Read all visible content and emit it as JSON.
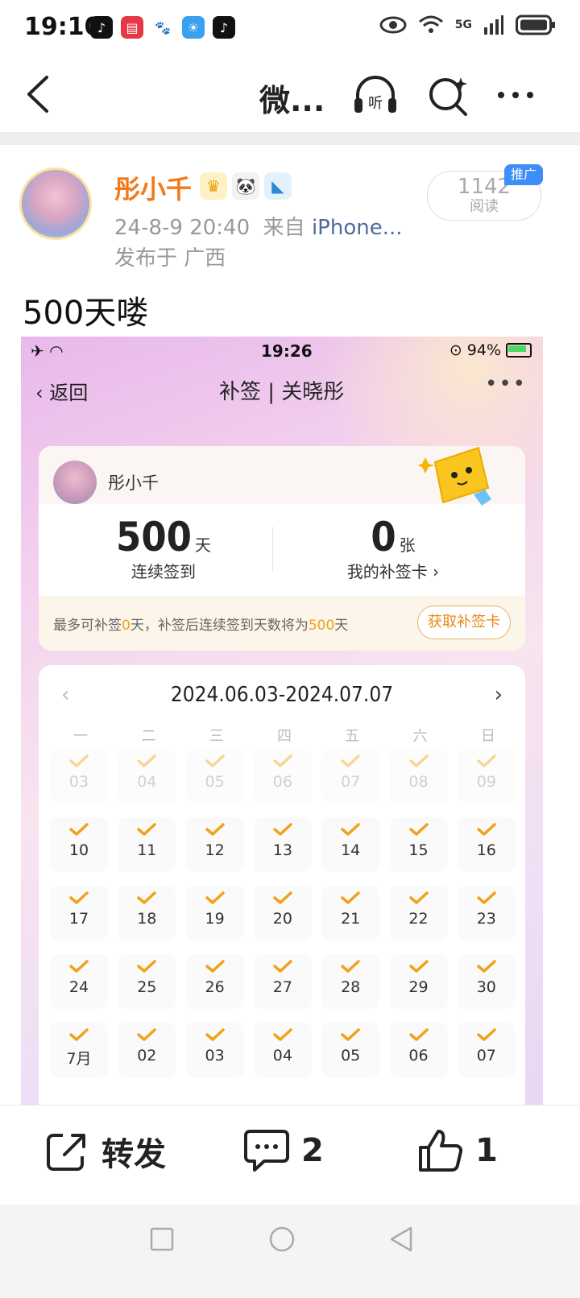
{
  "status_bar": {
    "time": "19:10",
    "network": "5G"
  },
  "nav": {
    "title": "微..."
  },
  "post": {
    "author": "彤小千",
    "date": "24-8-9 20:40",
    "source_prefix": "来自",
    "source": "iPhone...",
    "location": "发布于 广西",
    "read_count": "1142",
    "read_label": "阅读",
    "ad_tag": "推广",
    "text": "500天喽"
  },
  "screenshot": {
    "status_time": "19:26",
    "battery": "94%",
    "back_label": "返回",
    "title": "补签 | 关晓彤",
    "user_name": "彤小千",
    "streak_value": "500",
    "streak_unit": "天",
    "streak_label": "连续签到",
    "card_value": "0",
    "card_unit": "张",
    "card_label": "我的补签卡",
    "tip_a": "最多可补签",
    "tip_b": "0",
    "tip_c": "天，补签后连续签到天数将为",
    "tip_d": "500",
    "tip_e": "天",
    "get_card_button": "获取补签卡",
    "calendar_range": "2024.06.03-2024.07.07",
    "weekdays": [
      "一",
      "二",
      "三",
      "四",
      "五",
      "六",
      "日"
    ],
    "days": [
      "03",
      "04",
      "05",
      "06",
      "07",
      "08",
      "09",
      "10",
      "11",
      "12",
      "13",
      "14",
      "15",
      "16",
      "17",
      "18",
      "19",
      "20",
      "21",
      "22",
      "23",
      "24",
      "25",
      "26",
      "27",
      "28",
      "29",
      "30",
      "7月",
      "02",
      "03",
      "04",
      "05",
      "06",
      "07"
    ]
  },
  "actions": {
    "repost_label": "转发",
    "comment_count": "2",
    "like_count": "1"
  },
  "colors": {
    "accent_orange": "#f27a1a",
    "check_orange": "#f0a21a",
    "link_blue": "#506a9e",
    "ad_blue": "#3e8ef7"
  }
}
